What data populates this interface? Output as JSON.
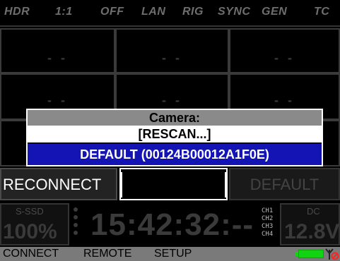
{
  "topbar": {
    "hdr": "HDR",
    "ratio": "1:1",
    "off": "OFF",
    "lan": "LAN",
    "rig": "RIG",
    "sync": "SYNC",
    "gen": "GEN",
    "tc": "TC"
  },
  "grid": {
    "placeholder": "- -"
  },
  "dialog": {
    "title": "Camera:",
    "rescan": "[RESCAN...]",
    "default_camera": "DEFAULT (00124B00012A1F0E)"
  },
  "buttons": {
    "reconnect": "RECONNECT",
    "default": "DEFAULT"
  },
  "status": {
    "media_label": "S-SSD",
    "media_percent": "100%",
    "timecode": "15:42:32:--",
    "channels": [
      "CH1",
      "CH2",
      "CH3",
      "CH4"
    ],
    "power_label": "DC",
    "voltage": "12.8V"
  },
  "menu": {
    "connect": "CONNECT",
    "remote": "REMOTE",
    "setup": "SETUP"
  },
  "icons": {
    "battery": "battery-icon",
    "antenna": "antenna-disconnected-icon"
  },
  "colors": {
    "selection": "#1414b4",
    "battery": "#11d311",
    "disconnected": "#ff2222"
  }
}
